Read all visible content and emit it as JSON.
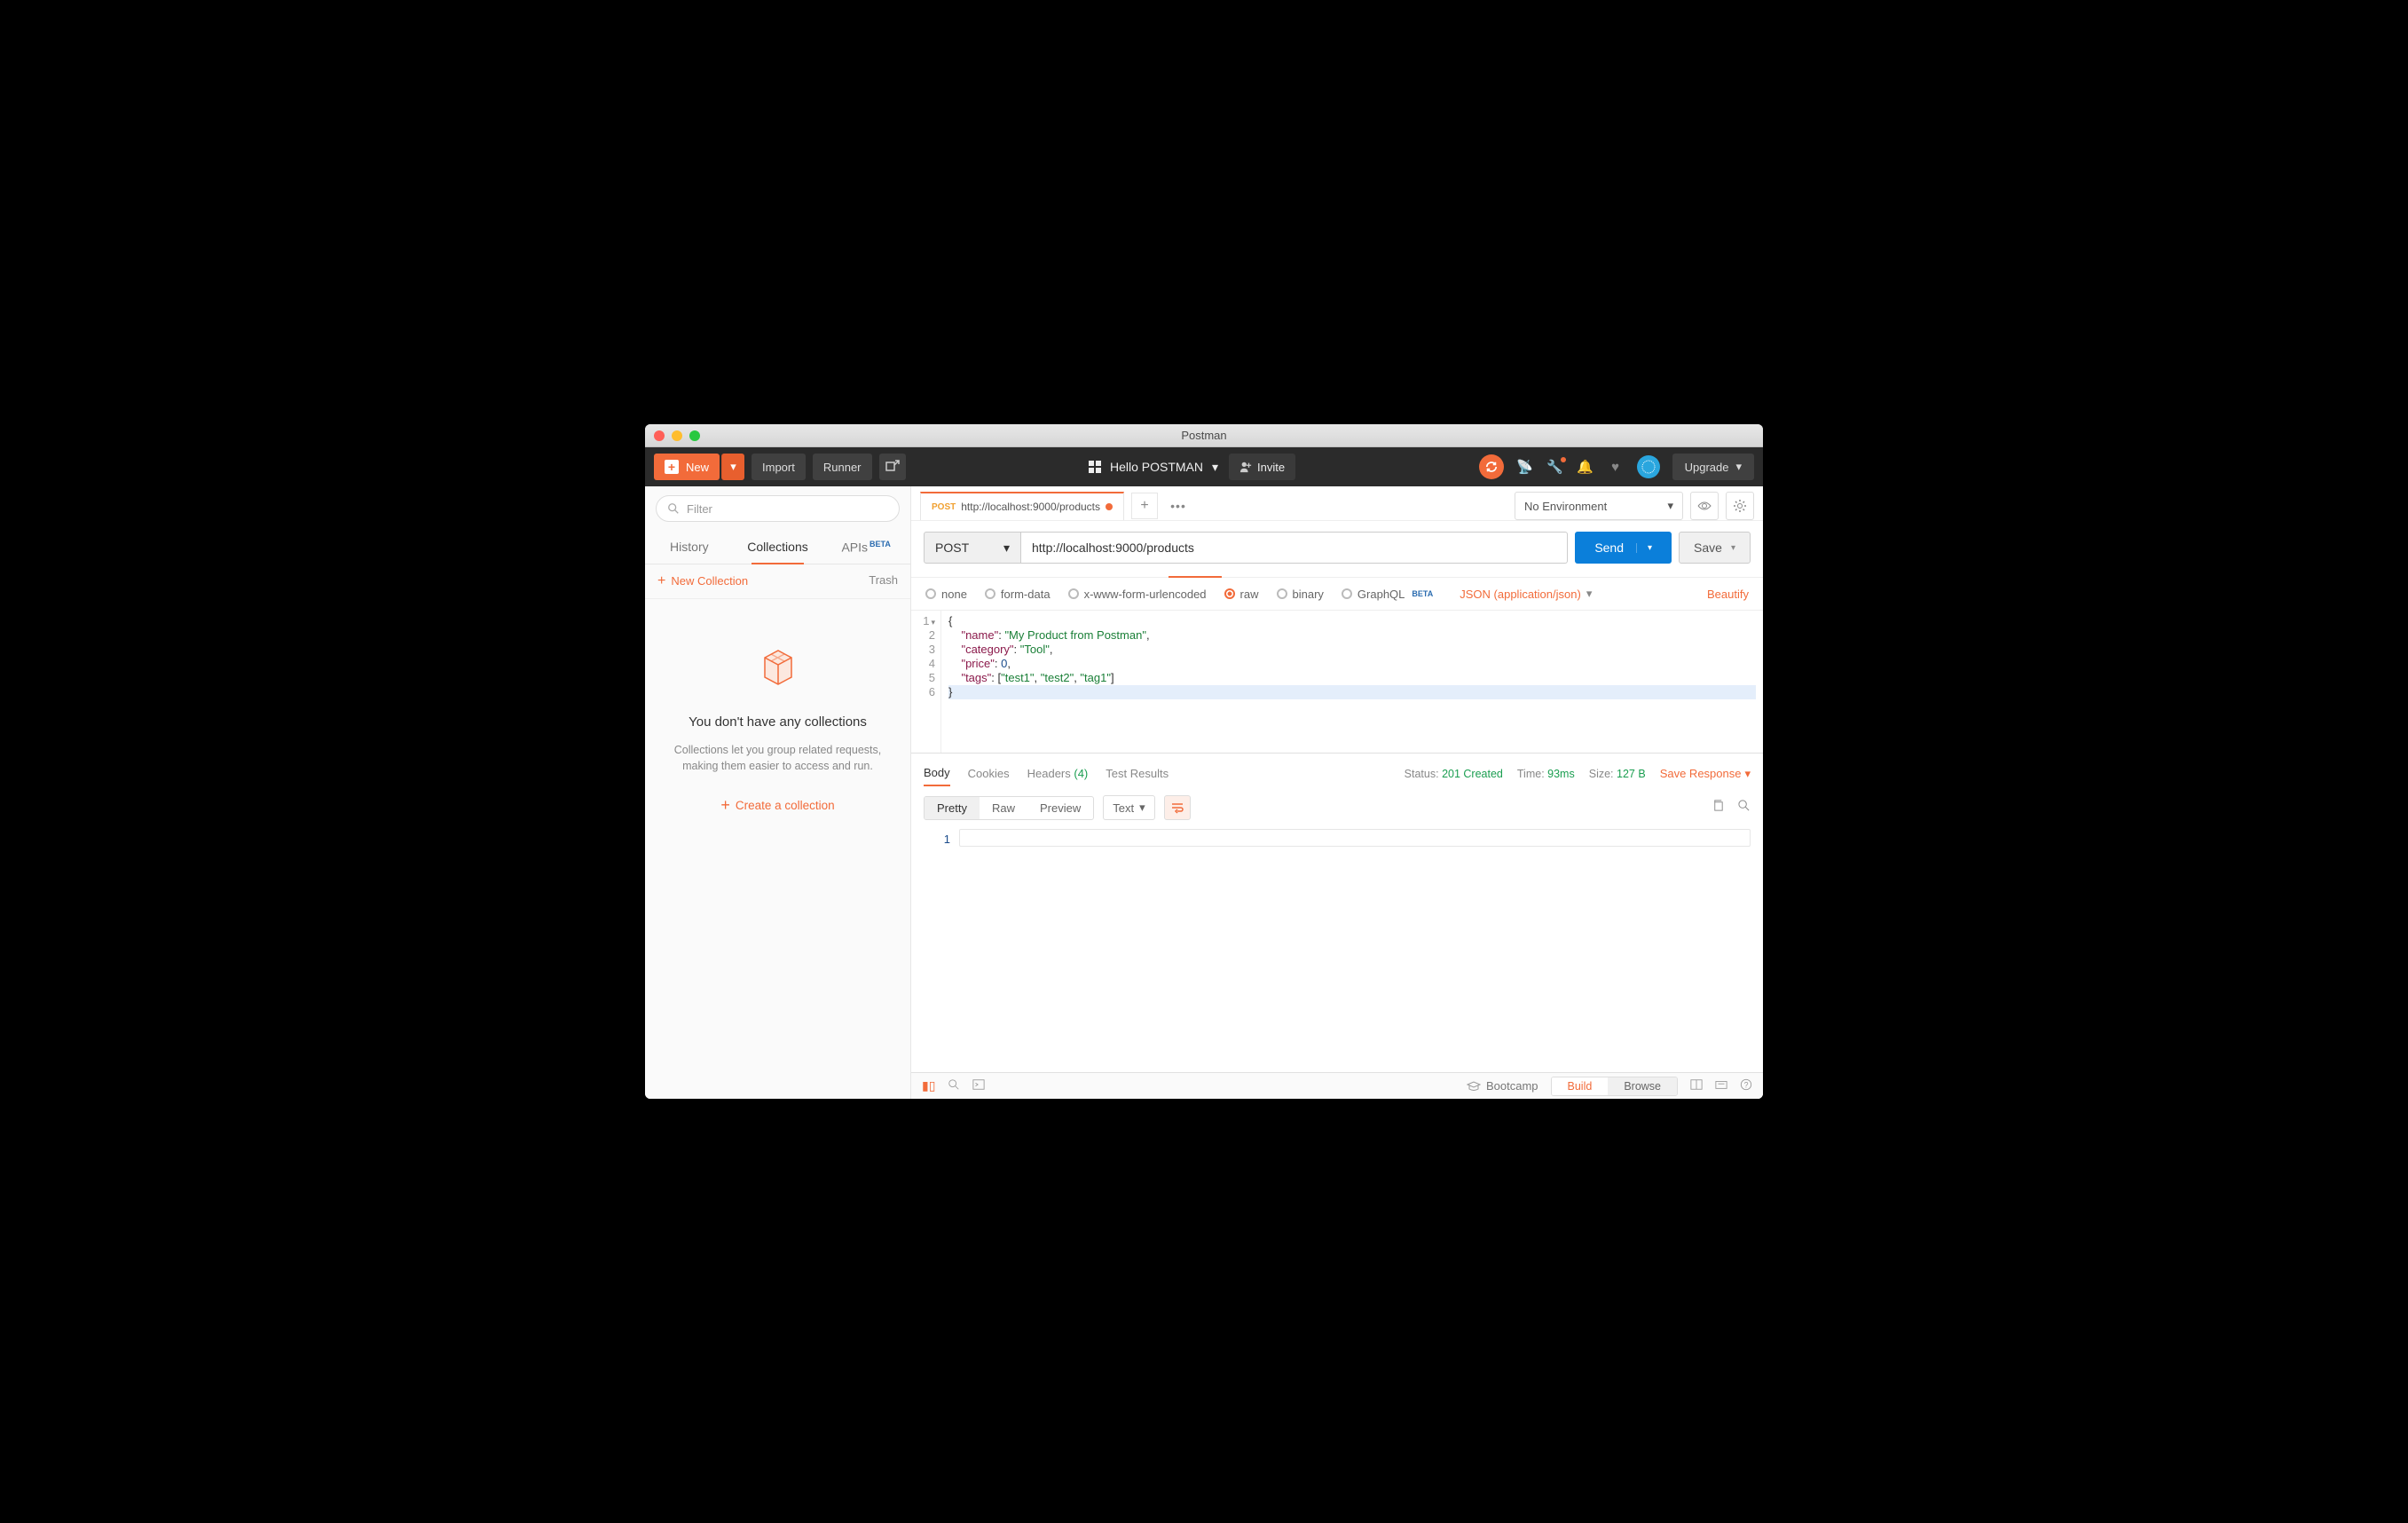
{
  "window": {
    "title": "Postman"
  },
  "toolbar": {
    "new": "New",
    "import": "Import",
    "runner": "Runner",
    "workspace": "Hello POSTMAN",
    "invite": "Invite",
    "upgrade": "Upgrade"
  },
  "sidebar": {
    "filter_placeholder": "Filter",
    "tabs": {
      "history": "History",
      "collections": "Collections",
      "apis": "APIs",
      "apis_badge": "BETA"
    },
    "new_collection": "New Collection",
    "trash": "Trash",
    "empty": {
      "title": "You don't have any collections",
      "desc": "Collections let you group related requests, making them easier to access and run.",
      "cta": "Create a collection"
    }
  },
  "env": {
    "selected": "No Environment"
  },
  "request_tab": {
    "method": "POST",
    "url": "http://localhost:9000/products"
  },
  "request": {
    "method": "POST",
    "url": "http://localhost:9000/products",
    "send": "Send",
    "save": "Save"
  },
  "body_types": {
    "none": "none",
    "form": "form-data",
    "url": "x-www-form-urlencoded",
    "raw": "raw",
    "binary": "binary",
    "graphql": "GraphQL",
    "graphql_badge": "BETA",
    "content_type": "JSON (application/json)",
    "beautify": "Beautify"
  },
  "body_json": {
    "name": "My Product from Postman",
    "category": "Tool",
    "price": 0,
    "tags": [
      "test1",
      "test2",
      "tag1"
    ]
  },
  "editor_lines": [
    "1",
    "2",
    "3",
    "4",
    "5",
    "6"
  ],
  "response": {
    "tabs": {
      "body": "Body",
      "cookies": "Cookies",
      "headers": "Headers",
      "headers_count": "(4)",
      "tests": "Test Results"
    },
    "status_lbl": "Status:",
    "status_val": "201 Created",
    "time_lbl": "Time:",
    "time_val": "93ms",
    "size_lbl": "Size:",
    "size_val": "127 B",
    "save": "Save Response",
    "view": {
      "pretty": "Pretty",
      "raw": "Raw",
      "preview": "Preview"
    },
    "format": "Text",
    "line": "1"
  },
  "statusbar": {
    "bootcamp": "Bootcamp",
    "build": "Build",
    "browse": "Browse"
  }
}
